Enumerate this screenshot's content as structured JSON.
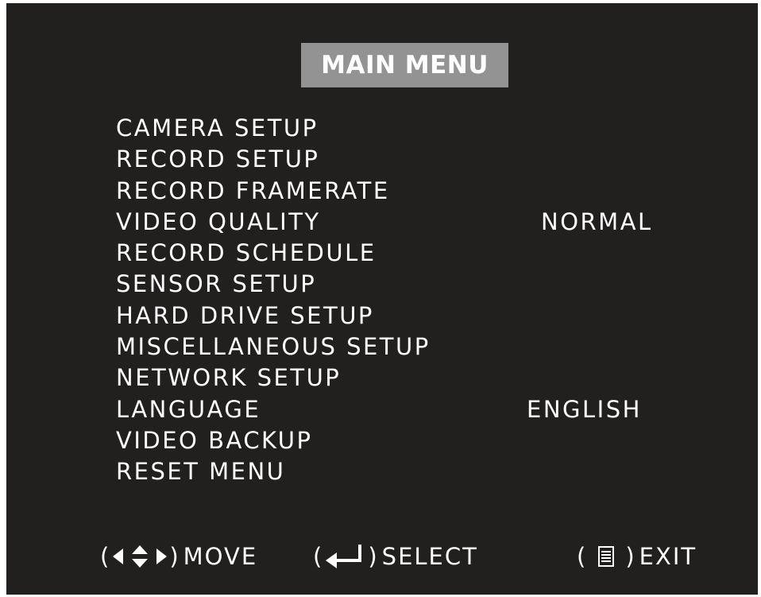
{
  "title": "MAIN MENU",
  "menu": {
    "items": [
      {
        "label": "CAMERA  SETUP",
        "value": null
      },
      {
        "label": "RECORD  SETUP",
        "value": null
      },
      {
        "label": "RECORD  FRAMERATE",
        "value": null
      },
      {
        "label": "VIDEO  QUALITY",
        "value": "NORMAL"
      },
      {
        "label": "RECORD  SCHEDULE",
        "value": null
      },
      {
        "label": "SENSOR  SETUP",
        "value": null
      },
      {
        "label": "HARD  DRIVE SETUP",
        "value": null
      },
      {
        "label": "MISCELLANEOUS  SETUP",
        "value": null
      },
      {
        "label": "NETWORK  SETUP",
        "value": null
      },
      {
        "label": "LANGUAGE",
        "value": "ENGLISH"
      },
      {
        "label": "VIDEO BACKUP",
        "value": null
      },
      {
        "label": "RESET  MENU",
        "value": null
      }
    ]
  },
  "footer": {
    "move": {
      "label": "MOVE",
      "open": "(",
      "close": ")",
      "icon": "four-way-arrows-icon"
    },
    "select": {
      "label": "SELECT",
      "open": "(",
      "close": ")",
      "icon": "enter-arrow-icon"
    },
    "exit": {
      "label": "EXIT",
      "open": "(",
      "close": ")",
      "icon": "menu-lines-icon"
    }
  },
  "colors": {
    "background": "#221f1f",
    "title_box": "#939393",
    "text": "#ffffff"
  }
}
